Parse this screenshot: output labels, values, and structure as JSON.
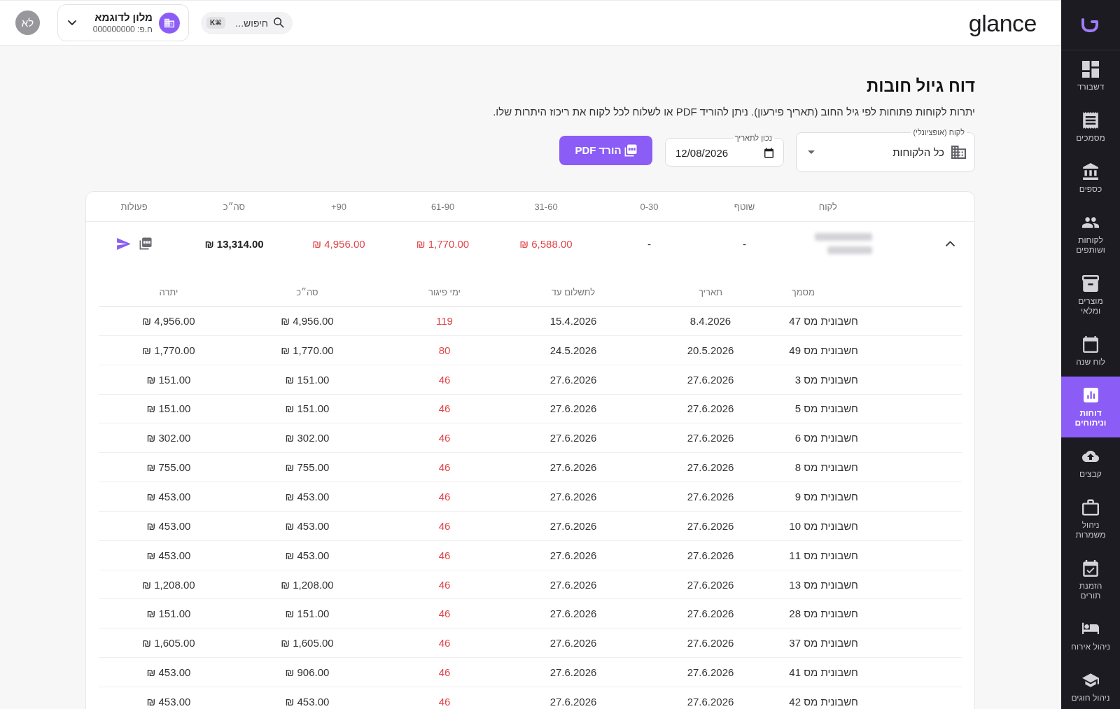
{
  "sidebar": {
    "items": [
      {
        "label": "דשבורד",
        "selected": false
      },
      {
        "label": "מסמכים",
        "selected": false
      },
      {
        "label": "כספים",
        "selected": false
      },
      {
        "label": "לקוחות\nושותפים",
        "selected": false
      },
      {
        "label": "מוצרים\nומלאי",
        "selected": false
      },
      {
        "label": "לוח שנה",
        "selected": false
      },
      {
        "label": "דוחות\nוניתוחים",
        "selected": true
      },
      {
        "label": "קבצים",
        "selected": false
      },
      {
        "label": "ניהול\nמשמרות",
        "selected": false
      },
      {
        "label": "הזמנת\nתורים",
        "selected": false
      },
      {
        "label": "ניהול אירוח",
        "selected": false
      },
      {
        "label": "ניהול חוגים",
        "selected": false
      }
    ]
  },
  "top_bar": {
    "logo": "glance",
    "search": {
      "label": "חיפוש...",
      "shortcut": "⌘K"
    },
    "business": {
      "name": "מלון לדוגמא",
      "id": "ח.פ: 000000000"
    },
    "avatar": "לא"
  },
  "page": {
    "title": "דוח גיול חובות",
    "subtitle": "יתרות לקוחות פתוחות לפי גיל החוב (תאריך פירעון). ניתן להוריד PDF או לשלוח לכל לקוח את ריכוז היתרות שלו.",
    "filters": {
      "customer": {
        "label": "לקוח (אופציונלי)",
        "value": "כל הלקוחות"
      },
      "date": {
        "label": "נכון לתאריך",
        "value": "12/08/2026"
      }
    },
    "download_button": "הורד PDF"
  },
  "table": {
    "columns": [
      "לקוח",
      "שוטף",
      "0-30",
      "31-60",
      "61-90",
      "+90",
      "סה״כ",
      "פעולות"
    ],
    "rows": [
      {
        "expanded": true,
        "amounts": [
          {
            "value": "-",
            "overdue": false
          },
          {
            "value": "-",
            "overdue": false
          },
          {
            "value": "₪ 6,588.00",
            "overdue": true
          },
          {
            "value": "₪ 1,770.00",
            "overdue": true
          },
          {
            "value": "₪ 4,956.00",
            "overdue": true
          }
        ],
        "total": "₪ 13,314.00",
        "details": {
          "columns": [
            "מסמך",
            "תאריך",
            "לתשלום עד",
            "ימי פיגור",
            "סה״כ",
            "יתרה"
          ],
          "rows": [
            {
              "document": "חשבונית מס 47",
              "date": "8.4.2026",
              "due": "15.4.2026",
              "days_late": "119",
              "total": "₪ 4,956.00",
              "balance": "₪ 4,956.00"
            },
            {
              "document": "חשבונית מס 49",
              "date": "20.5.2026",
              "due": "24.5.2026",
              "days_late": "80",
              "total": "₪ 1,770.00",
              "balance": "₪ 1,770.00"
            },
            {
              "document": "חשבונית מס 3",
              "date": "27.6.2026",
              "due": "27.6.2026",
              "days_late": "46",
              "total": "₪ 151.00",
              "balance": "₪ 151.00"
            },
            {
              "document": "חשבונית מס 5",
              "date": "27.6.2026",
              "due": "27.6.2026",
              "days_late": "46",
              "total": "₪ 151.00",
              "balance": "₪ 151.00"
            },
            {
              "document": "חשבונית מס 6",
              "date": "27.6.2026",
              "due": "27.6.2026",
              "days_late": "46",
              "total": "₪ 302.00",
              "balance": "₪ 302.00"
            },
            {
              "document": "חשבונית מס 8",
              "date": "27.6.2026",
              "due": "27.6.2026",
              "days_late": "46",
              "total": "₪ 755.00",
              "balance": "₪ 755.00"
            },
            {
              "document": "חשבונית מס 9",
              "date": "27.6.2026",
              "due": "27.6.2026",
              "days_late": "46",
              "total": "₪ 453.00",
              "balance": "₪ 453.00"
            },
            {
              "document": "חשבונית מס 10",
              "date": "27.6.2026",
              "due": "27.6.2026",
              "days_late": "46",
              "total": "₪ 453.00",
              "balance": "₪ 453.00"
            },
            {
              "document": "חשבונית מס 11",
              "date": "27.6.2026",
              "due": "27.6.2026",
              "days_late": "46",
              "total": "₪ 453.00",
              "balance": "₪ 453.00"
            },
            {
              "document": "חשבונית מס 13",
              "date": "27.6.2026",
              "due": "27.6.2026",
              "days_late": "46",
              "total": "₪ 1,208.00",
              "balance": "₪ 1,208.00"
            },
            {
              "document": "חשבונית מס 28",
              "date": "27.6.2026",
              "due": "27.6.2026",
              "days_late": "46",
              "total": "₪ 151.00",
              "balance": "₪ 151.00"
            },
            {
              "document": "חשבונית מס 37",
              "date": "27.6.2026",
              "due": "27.6.2026",
              "days_late": "46",
              "total": "₪ 1,605.00",
              "balance": "₪ 1,605.00"
            },
            {
              "document": "חשבונית מס 41",
              "date": "27.6.2026",
              "due": "27.6.2026",
              "days_late": "46",
              "total": "₪ 906.00",
              "balance": "₪ 453.00"
            },
            {
              "document": "חשבונית מס 42",
              "date": "27.6.2026",
              "due": "27.6.2026",
              "days_late": "46",
              "total": "₪ 453.00",
              "balance": "₪ 453.00"
            }
          ]
        }
      }
    ]
  }
}
